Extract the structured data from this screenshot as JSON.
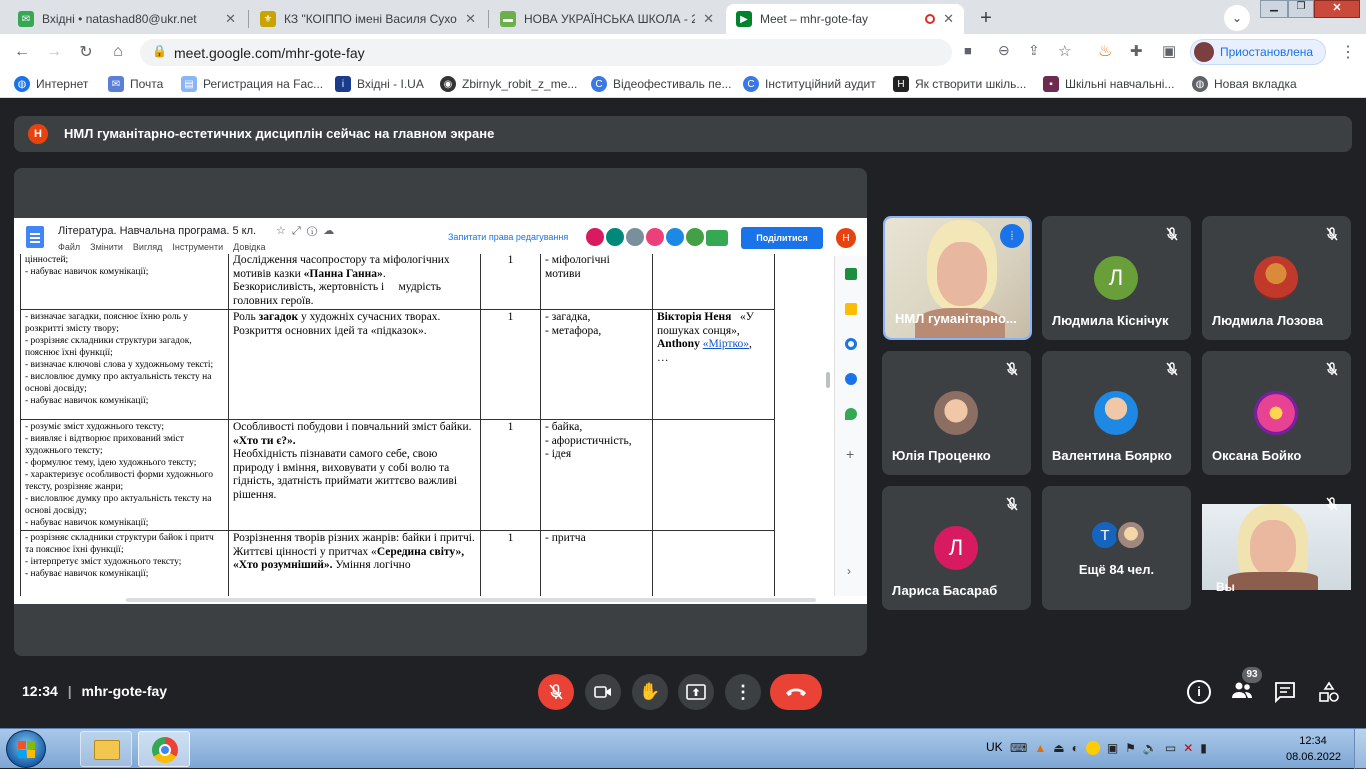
{
  "browser": {
    "tabs": [
      {
        "title": "Вхідні • natashad80@ukr.net",
        "icon": "mail-icon",
        "color": "#34a853"
      },
      {
        "title": "КЗ \"КОІППО імені Василя Сухом",
        "icon": "crest-icon",
        "color": "#c8a400"
      },
      {
        "title": "НОВА УКРАЇНСЬКА ШКОЛА - 20",
        "icon": "nus-icon",
        "color": "#6ab04c"
      },
      {
        "title": "Meet – mhr-gote-fay",
        "icon": "meet-icon",
        "color": "#00832d",
        "active": true
      }
    ],
    "url": "meet.google.com/mhr-gote-fay",
    "profile_status": "Приостановлена",
    "bookmarks": [
      {
        "label": "Интернет",
        "icon": "globe-icon",
        "color": "#1a73e8"
      },
      {
        "label": "Почта",
        "icon": "mail-icon",
        "color": "#5b7fd4"
      },
      {
        "label": "Регистрация на Fac...",
        "icon": "page-icon",
        "color": "#8ab4f8"
      },
      {
        "label": "Вхідні - I.UA",
        "icon": "iua-icon",
        "color": "#1a3c8c"
      },
      {
        "label": "Zbirnyk_robit_z_me...",
        "icon": "github-icon",
        "color": "#333333"
      },
      {
        "label": "Відеофестиваль пе...",
        "icon": "c-icon",
        "color": "#3b78e7"
      },
      {
        "label": "Інституційний аудит",
        "icon": "c-icon",
        "color": "#3b78e7"
      },
      {
        "label": "Як створити шкіль...",
        "icon": "h-icon",
        "color": "#222222"
      },
      {
        "label": "Шкільні навчальні...",
        "icon": "book-icon",
        "color": "#6d2b4f"
      },
      {
        "label": "Новая вкладка",
        "icon": "globe-icon",
        "color": "#5f6368"
      }
    ]
  },
  "meet": {
    "banner_initial": "Н",
    "banner_text": "НМЛ гуманітарно-естетичних дисциплін сейчас на главном экране",
    "time": "12:34",
    "meeting_code": "mhr-gote-fay",
    "people_count": "93",
    "participants": [
      {
        "name": "НМЛ гуманітарно...",
        "type": "video",
        "speaking": true
      },
      {
        "name": "Людмила Кіснічук",
        "initial": "Л",
        "avatar_color": "#689f38"
      },
      {
        "name": "Людмила Лозова",
        "type": "photo",
        "photo_color": "#c0392b"
      },
      {
        "name": "Юлія Проценко",
        "type": "photo",
        "photo_color": "#8d6e63"
      },
      {
        "name": "Валентина Боярко",
        "type": "photo",
        "photo_color": "#1e88e5"
      },
      {
        "name": "Оксана Бойко",
        "type": "photo",
        "photo_color": "#e84393"
      },
      {
        "name": "Лариса Басараб",
        "initial": "Л",
        "avatar_color": "#d81b60"
      },
      {
        "name": "Ещё 84 чел.",
        "type": "more",
        "initial": "Т",
        "avatar_color": "#1565c0"
      },
      {
        "name": "Вы",
        "type": "self"
      }
    ]
  },
  "doc": {
    "title": "Література. Навчальна  програма. 5 кл.",
    "menu": [
      "Файл",
      "Змінити",
      "Вигляд",
      "Інструменти",
      "Довідка"
    ],
    "request_edit": "Запитати права редагування",
    "share": "Поділитися",
    "user_initial": "Н",
    "rows": [
      {
        "c1": "цінностей;\n- набуває навичок комунікації;",
        "c2_html": "Дослідження часопростору та міфологічних мотивів казки <b>«Панна Ганна»</b>.\nБезкорисливість, жертовність і&nbsp;&nbsp;&nbsp;&nbsp; мудрість головних героїв.",
        "c3": "1",
        "c4": "- міфологічні\nмотиви",
        "c5_html": ""
      },
      {
        "c1": "- визначає загадки, пояснює їхню роль  у розкритті змісту твору;\n- розрізняє складники структури загадок, пояснює їхні функції;\n- визначає ключові слова у художньому тексті;\n- висловлює думку про актуальність тексту на основі досвіду;\n- набуває навичок комунікації;",
        "c2_html": "Роль <b>загадок</b> у художніх сучасних творах. Розкриття основних ідей та «підказок».",
        "c3": "1",
        "c4": "- загадка,\n- метафора,",
        "c5_html": "<b>Вікторія Неня</b>&nbsp;&nbsp; «У пошуках сонця»,\n<b>Anthony</b> <u style=\"color:#1155cc\">«Міртко»</u>,\n…"
      },
      {
        "c1": "- розуміє  зміст художнього  тексту;\n- виявляє і відтворює прихований зміст художнього тексту;\n- формулює тему, ідею художнього тексту;\n- характеризує особливості форми художнього тексту, розрізняє жанри;\n- висловлює думку про актуальність тексту на основі досвіду;\n- набуває навичок комунікації;",
        "c2_html": "Особливості побудови і повчальний зміст байки. <b>«Хто ти є?».</b>\nНеобхідність пізнавати самого себе, свою природу і вміння,  виховувати у собі волю та гідність, здатність приймати життєво важливі рішення.",
        "c3": "1",
        "c4": "- байка,\n- афористичність,\n- ідея",
        "c5_html": ""
      },
      {
        "c1": "- розрізняє складники структури байок і притч та пояснює їхні функції;\n- інтерпретує зміст художнього тексту;\n- набуває навичок комунікації;",
        "c2_html": "Розрізнення творів різних жанрів: байки і притчі.\nЖиттєві цінності у притчах «<b>Середина світу», «Хто розумніший».</b> Уміння логічно",
        "c3": "1",
        "c4": "- притча",
        "c5_html": ""
      }
    ]
  },
  "taskbar": {
    "lang": "UK",
    "time": "12:34",
    "date": "08.06.2022"
  }
}
